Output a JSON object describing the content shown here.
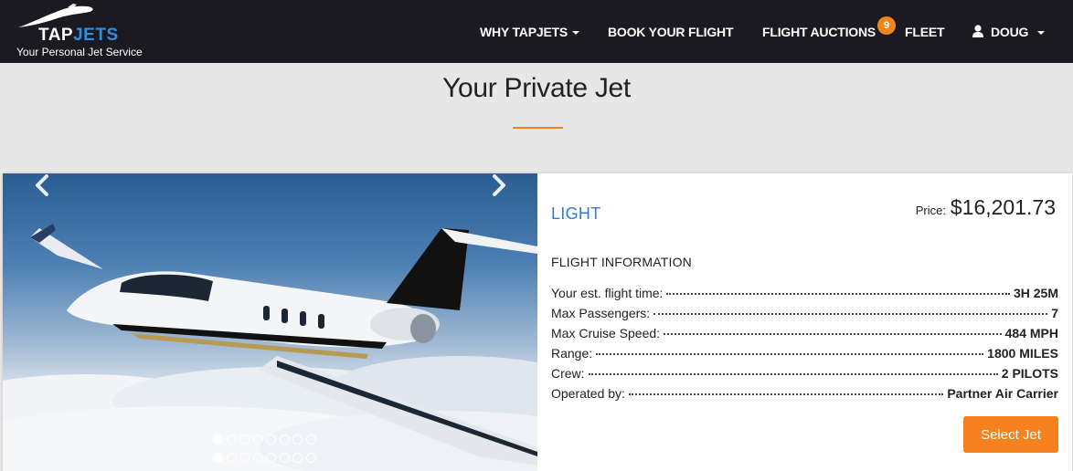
{
  "brand": {
    "logo_tap": "TAP",
    "logo_jets": "JETS",
    "tagline": "Your Personal Jet Service",
    "accent_color": "#f0851c",
    "link_color": "#2f7cd6"
  },
  "nav": {
    "why": "WHY TAPJETS",
    "book": "BOOK YOUR FLIGHT",
    "auctions": "FLIGHT AUCTIONS",
    "auctions_badge": "9",
    "fleet": "FLEET",
    "user": "DOUG"
  },
  "page": {
    "title": "Your Private Jet"
  },
  "jet": {
    "category": "LIGHT",
    "price_label": "Price:",
    "price": "$16,201.73",
    "section_heading": "FLIGHT INFORMATION",
    "specs": [
      {
        "label": "Your est. flight time:",
        "value": "3H 25M"
      },
      {
        "label": "Max Passengers:",
        "value": "7"
      },
      {
        "label": "Max Cruise Speed:",
        "value": "484 MPH"
      },
      {
        "label": "Range:",
        "value": "1800 MILES"
      },
      {
        "label": "Crew:",
        "value": "2 PILOTS"
      },
      {
        "label": "Operated by:",
        "value": "Partner Air Carrier"
      }
    ],
    "select_label": "Select Jet"
  },
  "gallery": {
    "prev_icon": "chevron-left-icon",
    "next_icon": "chevron-right-icon",
    "dot_count": 8,
    "active_dot": 1
  }
}
